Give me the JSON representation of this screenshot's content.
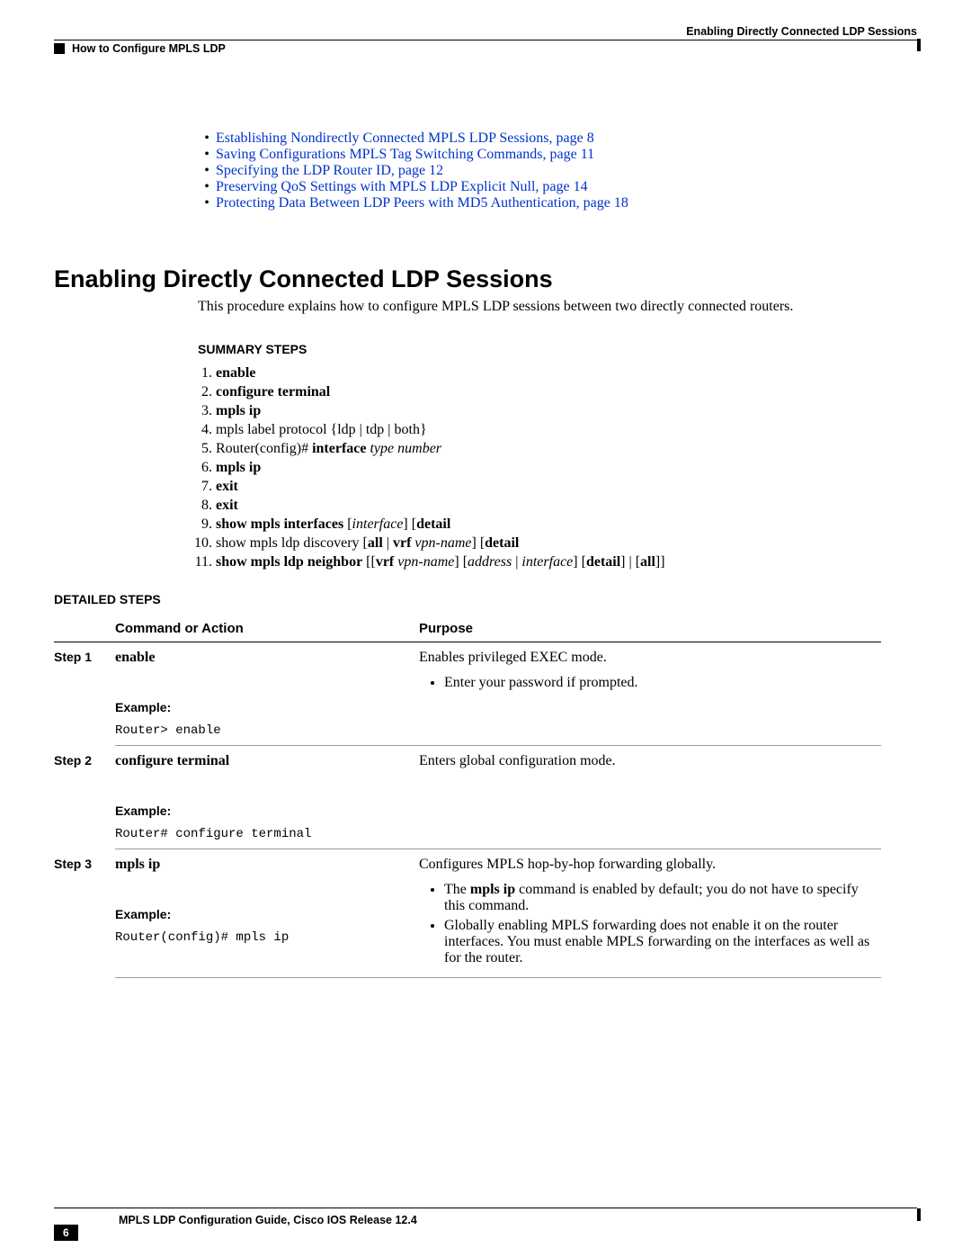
{
  "header": {
    "right_title": "Enabling Directly Connected LDP Sessions",
    "left_breadcrumb": "How to Configure MPLS LDP"
  },
  "toc": [
    "Establishing Nondirectly Connected MPLS LDP Sessions,  page 8",
    "Saving Configurations MPLS Tag Switching Commands,  page 11",
    "Specifying the LDP Router ID,  page 12",
    "Preserving QoS Settings with MPLS LDP Explicit Null,  page 14",
    "Protecting Data Between LDP Peers with MD5 Authentication,  page 18"
  ],
  "section": {
    "title": "Enabling Directly Connected LDP Sessions",
    "intro": "This procedure explains how to configure MPLS LDP sessions between two directly connected routers."
  },
  "summary": {
    "heading": "SUMMARY STEPS",
    "steps": [
      {
        "num": "1.",
        "html": "<b>enable</b>"
      },
      {
        "num": "2.",
        "html": "<b>configure terminal</b>"
      },
      {
        "num": "3.",
        "html": "<b>mpls ip</b>"
      },
      {
        "num": "4.",
        "html": "mpls label protocol {ldp | tdp | both}"
      },
      {
        "num": "5.",
        "html": "Router(config)# <b>interface</b> <i>type number</i>"
      },
      {
        "num": "6.",
        "html": "<b>mpls ip</b>"
      },
      {
        "num": "7.",
        "html": "<b>exit</b>"
      },
      {
        "num": "8.",
        "html": "<b>exit</b>"
      },
      {
        "num": "9.",
        "html": "<b>show mpls interfaces</b> [<i>interface</i>] [<b>detail</b>"
      },
      {
        "num": "10.",
        "html": "show mpls ldp discovery [<b>all</b> | <b>vrf</b> <i>vpn-name</i>] [<b>detail</b>"
      },
      {
        "num": "11.",
        "html": "<b>show mpls ldp neighbor</b> [[<b>vrf</b> <i>vpn-name</i>] [<i>address</i> | <i>interface</i>] [<b>detail</b>] | [<b>all</b>]]"
      }
    ]
  },
  "detailed": {
    "heading": "DETAILED STEPS",
    "col1": "Command or Action",
    "col2": "Purpose",
    "example_label": "Example:",
    "rows": [
      {
        "step": "Step 1",
        "cmd": "enable",
        "example": "Router> enable",
        "purpose_main": "Enables privileged EXEC mode.",
        "purpose_bullets": [
          "Enter your password if prompted."
        ]
      },
      {
        "step": "Step 2",
        "cmd": "configure terminal",
        "example": "Router# configure terminal",
        "purpose_main": "Enters global configuration mode.",
        "purpose_bullets": []
      },
      {
        "step": "Step 3",
        "cmd": "mpls ip",
        "example": "Router(config)# mpls ip",
        "purpose_main": "Configures MPLS hop-by-hop forwarding globally.",
        "purpose_bullets": [
          "The <b>mpls ip</b> command is enabled by default; you do not have to specify this command.",
          "Globally enabling MPLS forwarding does not enable it on the router interfaces. You must enable MPLS forwarding on the interfaces as well as for the router."
        ]
      }
    ]
  },
  "footer": {
    "doc_title": "MPLS LDP Configuration Guide, Cisco IOS Release 12.4",
    "page_number": "6"
  }
}
